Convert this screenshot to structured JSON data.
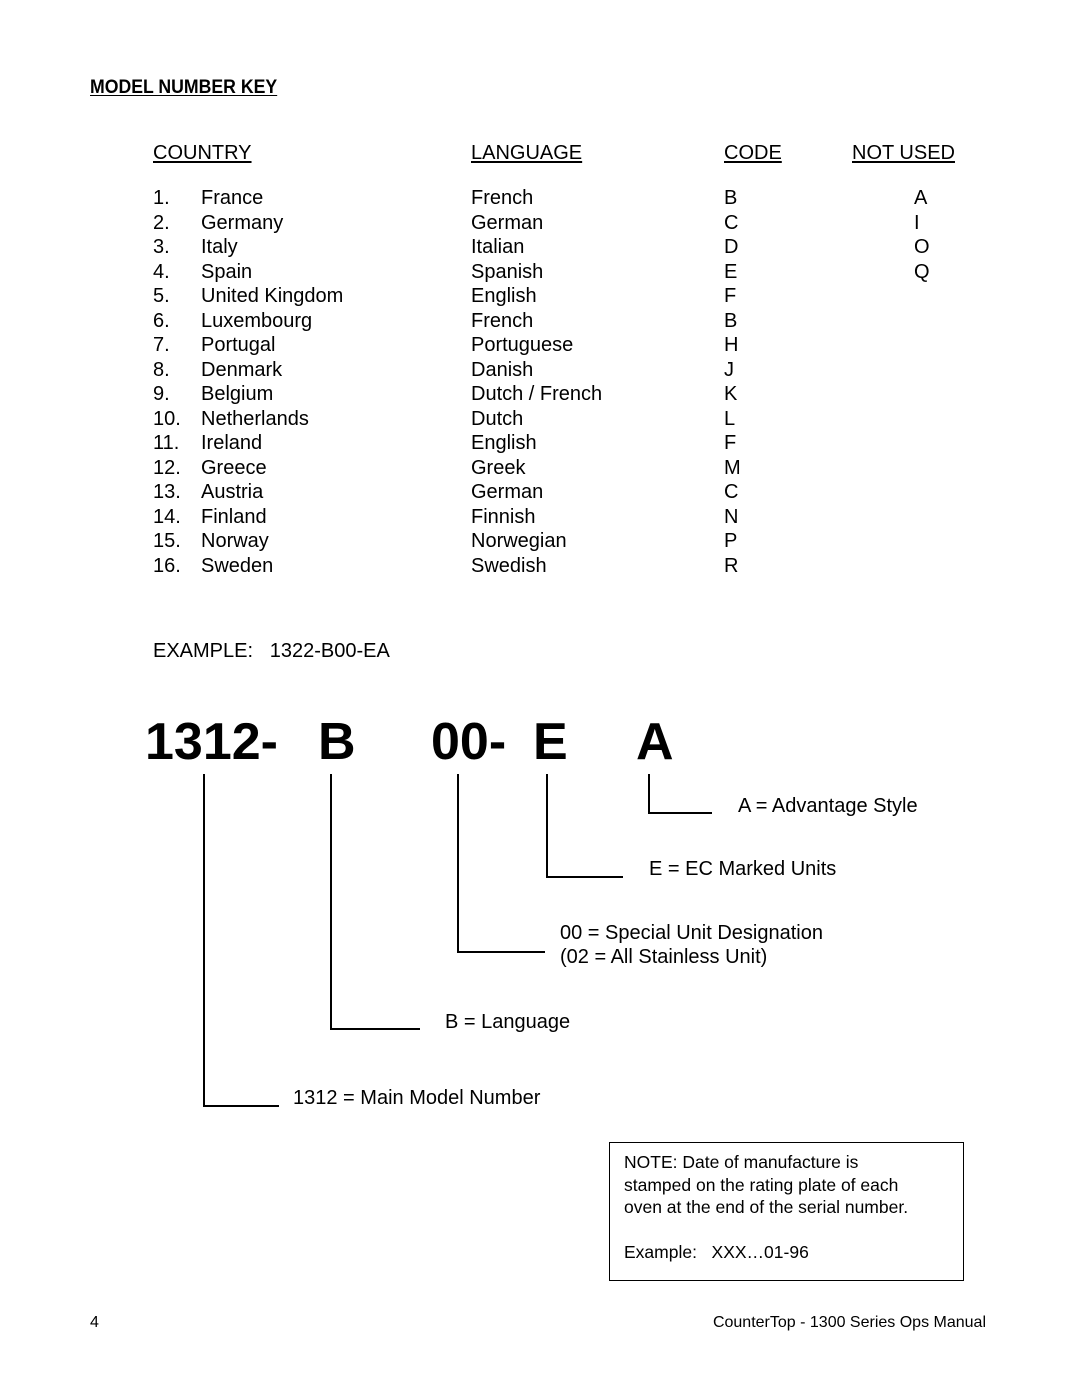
{
  "heading": "MODEL NUMBER KEY",
  "table": {
    "columns": {
      "country": "COUNTRY",
      "language": "LANGUAGE",
      "code": "CODE",
      "not_used": "NOT USED"
    },
    "rows": [
      {
        "num": "1.",
        "country": "France",
        "language": "French",
        "code": "B",
        "not_used": "A"
      },
      {
        "num": "2.",
        "country": "Germany",
        "language": "German",
        "code": "C",
        "not_used": "I"
      },
      {
        "num": "3.",
        "country": "Italy",
        "language": "Italian",
        "code": "D",
        "not_used": "O"
      },
      {
        "num": "4.",
        "country": "Spain",
        "language": "Spanish",
        "code": "E",
        "not_used": "Q"
      },
      {
        "num": "5.",
        "country": "United Kingdom",
        "language": "English",
        "code": "F",
        "not_used": ""
      },
      {
        "num": "6.",
        "country": "Luxembourg",
        "language": "French",
        "code": "B",
        "not_used": ""
      },
      {
        "num": "7.",
        "country": "Portugal",
        "language": "Portuguese",
        "code": "H",
        "not_used": ""
      },
      {
        "num": "8.",
        "country": "Denmark",
        "language": "Danish",
        "code": "J",
        "not_used": ""
      },
      {
        "num": "9.",
        "country": "Belgium",
        "language": "Dutch / French",
        "code": "K",
        "not_used": ""
      },
      {
        "num": "10.",
        "country": "Netherlands",
        "language": "Dutch",
        "code": "L",
        "not_used": ""
      },
      {
        "num": "11.",
        "country": "Ireland",
        "language": "English",
        "code": "F",
        "not_used": ""
      },
      {
        "num": "12.",
        "country": "Greece",
        "language": "Greek",
        "code": "M",
        "not_used": ""
      },
      {
        "num": "13.",
        "country": "Austria",
        "language": "German",
        "code": "C",
        "not_used": ""
      },
      {
        "num": "14.",
        "country": "Finland",
        "language": "Finnish",
        "code": "N",
        "not_used": ""
      },
      {
        "num": "15.",
        "country": "Norway",
        "language": "Norwegian",
        "code": "P",
        "not_used": ""
      },
      {
        "num": "16.",
        "country": "Sweden",
        "language": "Swedish",
        "code": "R",
        "not_used": ""
      }
    ]
  },
  "example": {
    "label": "EXAMPLE:",
    "value": "1322-B00-EA"
  },
  "diagram": {
    "parts": [
      "1312-",
      "B",
      "00-",
      "E",
      "A"
    ],
    "labels": {
      "a": "A = Advantage Style",
      "e": "E = EC Marked Units",
      "special_1": "00 = Special Unit Designation",
      "special_2": "(02 = All Stainless Unit)",
      "b": "B = Language",
      "main": "1312 = Main Model Number"
    }
  },
  "note": {
    "lines": [
      "NOTE: Date of manufacture is",
      "stamped on the rating plate of each",
      "oven at the end of the serial number."
    ],
    "example": "Example:   XXX…01-96"
  },
  "footer": {
    "page_number": "4",
    "manual_title": "CounterTop - 1300 Series Ops Manual"
  }
}
